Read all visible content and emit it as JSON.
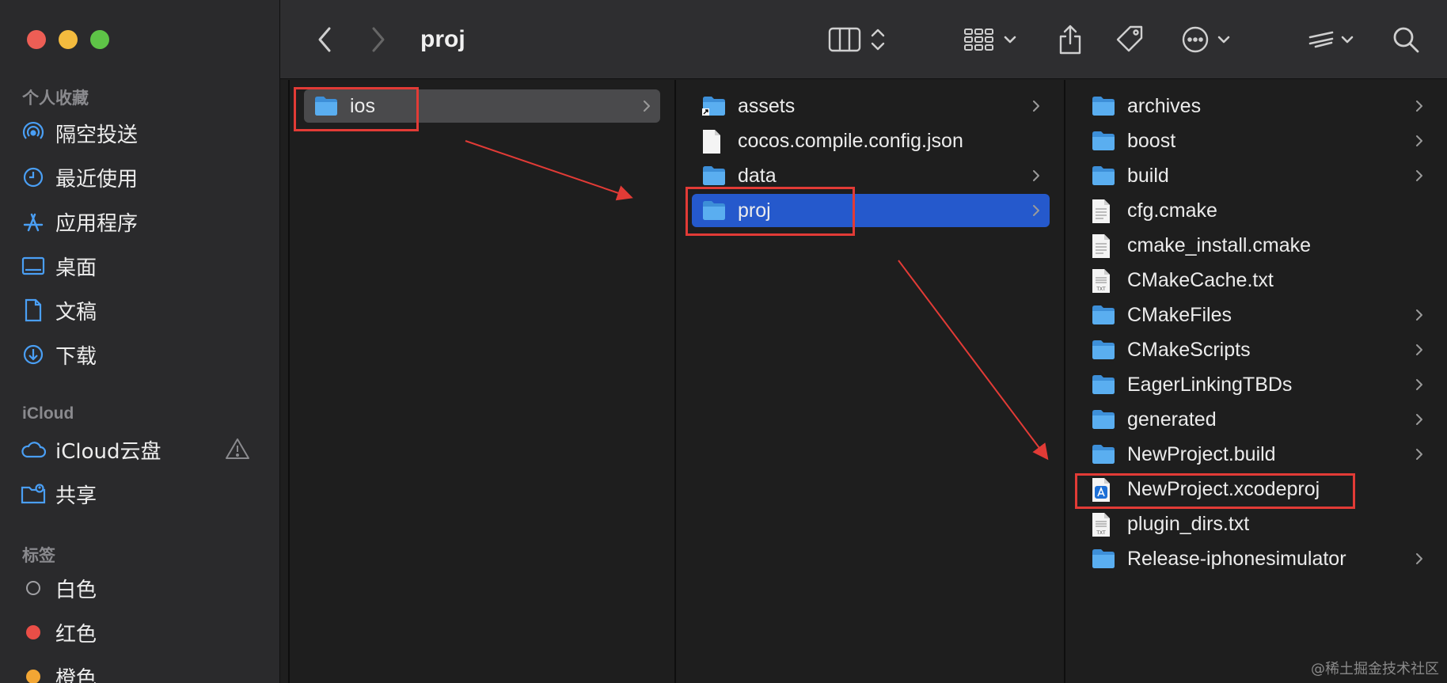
{
  "window": {
    "title": "proj"
  },
  "colors": {
    "close": "#ed5e55",
    "minimize": "#f3bb3e",
    "zoom": "#5ec447",
    "folder": "#5aaef0",
    "selection_blue": "#2559cc",
    "selection_gray": "#4a4a4c",
    "annotation": "#e23b36",
    "tag_red": "#ea4e47",
    "tag_orange": "#f2a634"
  },
  "sidebar": {
    "favorites_title": "个人收藏",
    "favorites": [
      {
        "label": "隔空投送",
        "icon": "airdrop-icon"
      },
      {
        "label": "最近使用",
        "icon": "clock-icon"
      },
      {
        "label": "应用程序",
        "icon": "applications-icon"
      },
      {
        "label": "桌面",
        "icon": "desktop-icon"
      },
      {
        "label": "文稿",
        "icon": "document-icon"
      },
      {
        "label": "下载",
        "icon": "download-icon"
      }
    ],
    "icloud_title": "iCloud",
    "icloud": [
      {
        "label": "iCloud云盘",
        "icon": "cloud-icon"
      },
      {
        "label": "共享",
        "icon": "shared-folder-icon"
      }
    ],
    "tags_title": "标签",
    "tags": [
      {
        "label": "白色",
        "icon": "tag-white-icon"
      },
      {
        "label": "红色",
        "icon": "tag-red-icon"
      },
      {
        "label": "橙色",
        "icon": "tag-orange-icon"
      }
    ]
  },
  "columns": [
    [
      {
        "name": "ios",
        "type": "folder",
        "chevron": true,
        "selected": "gray"
      }
    ],
    [
      {
        "name": "assets",
        "type": "folder-alias",
        "chevron": true
      },
      {
        "name": "cocos.compile.config.json",
        "type": "file",
        "chevron": false
      },
      {
        "name": "data",
        "type": "folder",
        "chevron": true
      },
      {
        "name": "proj",
        "type": "folder",
        "chevron": true,
        "selected": "blue"
      }
    ],
    [
      {
        "name": "archives",
        "type": "folder",
        "chevron": true
      },
      {
        "name": "boost",
        "type": "folder",
        "chevron": true
      },
      {
        "name": "build",
        "type": "folder",
        "chevron": true
      },
      {
        "name": "cfg.cmake",
        "type": "text",
        "chevron": false
      },
      {
        "name": "cmake_install.cmake",
        "type": "text",
        "chevron": false
      },
      {
        "name": "CMakeCache.txt",
        "type": "txt",
        "chevron": false
      },
      {
        "name": "CMakeFiles",
        "type": "folder",
        "chevron": true
      },
      {
        "name": "CMakeScripts",
        "type": "folder",
        "chevron": true
      },
      {
        "name": "EagerLinkingTBDs",
        "type": "folder",
        "chevron": true
      },
      {
        "name": "generated",
        "type": "folder",
        "chevron": true
      },
      {
        "name": "NewProject.build",
        "type": "folder",
        "chevron": true
      },
      {
        "name": "NewProject.xcodeproj",
        "type": "xcode",
        "chevron": false
      },
      {
        "name": "plugin_dirs.txt",
        "type": "txt",
        "chevron": false
      },
      {
        "name": "Release-iphonesimulator",
        "type": "folder",
        "chevron": true
      }
    ]
  ],
  "watermark": "@稀土掘金技术社区"
}
